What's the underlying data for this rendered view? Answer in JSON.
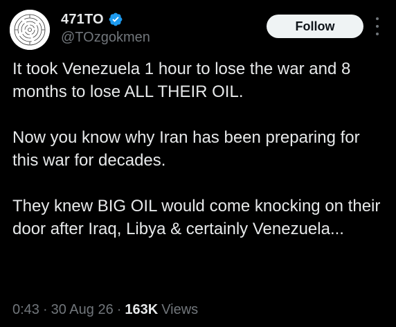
{
  "author": {
    "display_name": "471TO",
    "handle": "@TOzgokmen",
    "verified_icon": "verified-badge-icon",
    "avatar_icon": "circular-maze-avatar"
  },
  "actions": {
    "follow_label": "Follow",
    "more_icon": "more-vertical-icon"
  },
  "tweet": {
    "paragraphs": [
      "It took Venezuela 1 hour to lose the war and 8 months to lose ALL THEIR OIL.",
      "Now you know why Iran has been preparing for this war for decades.",
      "They knew BIG OIL would come knocking on their door after Iraq, Libya & certainly Venezuela..."
    ]
  },
  "meta": {
    "time": "0:43",
    "separator": "·",
    "date": "30 Aug 26",
    "views_count": "163K",
    "views_label": "Views"
  },
  "colors": {
    "background": "#000000",
    "text_primary": "#e7e9ea",
    "text_secondary": "#71767b",
    "verified": "#1d9bf0",
    "follow_bg": "#eff3f4",
    "follow_text": "#0f1419"
  }
}
